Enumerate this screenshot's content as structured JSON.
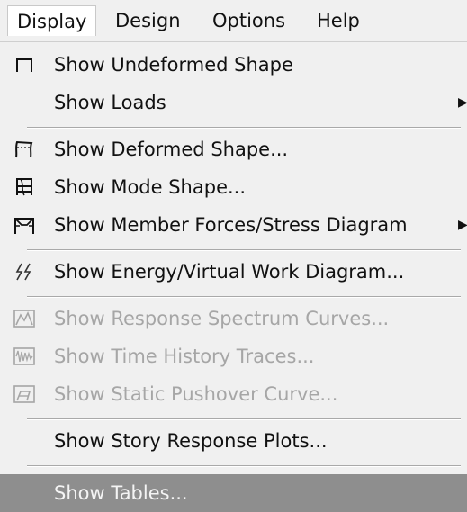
{
  "menubar": {
    "display": "Display",
    "design": "Design",
    "options": "Options",
    "help": "Help"
  },
  "menu": {
    "show_undeformed_shape": "Show Undeformed Shape",
    "show_loads": "Show Loads",
    "show_deformed_shape": "Show  Deformed Shape...",
    "show_mode_shape": "Show  Mode Shape...",
    "show_member_forces": "Show Member Forces/Stress Diagram",
    "show_energy": "Show Energy/Virtual Work Diagram...",
    "show_response_spectrum": "Show Response Spectrum Curves...",
    "show_time_history": "Show Time History Traces...",
    "show_static_pushover": "Show Static Pushover Curve...",
    "show_story_response": "Show Story Response Plots...",
    "show_tables": "Show Tables..."
  },
  "icons": {
    "undeformed": "undeformed-frame-icon",
    "deformed": "deformed-frame-icon",
    "mode": "mode-shape-icon",
    "member_forces": "member-forces-icon",
    "energy": "energy-icon",
    "response_spectrum": "response-spectrum-icon",
    "time_history": "time-history-icon",
    "pushover": "pushover-icon"
  },
  "colors": {
    "background": "#f0f0f0",
    "highlight": "#8e8e8e",
    "disabled_text": "#a6a6a6"
  }
}
